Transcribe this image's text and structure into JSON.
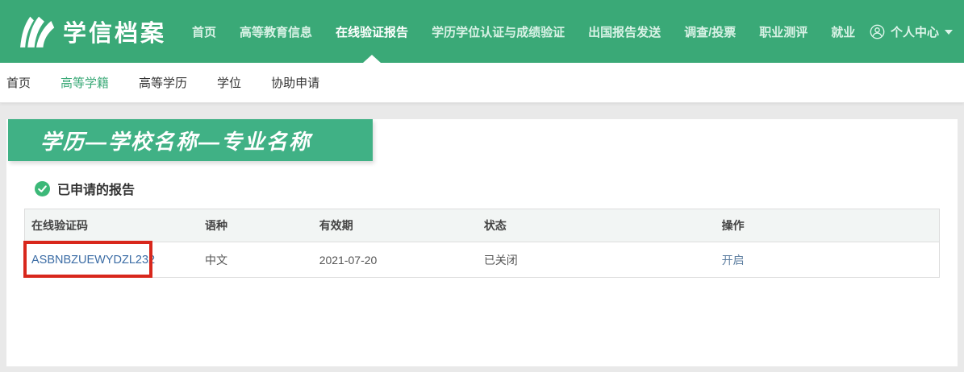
{
  "header": {
    "brand": "学信档案",
    "nav": [
      "首页",
      "高等教育信息",
      "在线验证报告",
      "学历学位认证与成绩验证",
      "出国报告发送",
      "调查/投票",
      "职业测评",
      "就业"
    ],
    "active_nav": "在线验证报告",
    "user_label": "个人中心"
  },
  "subnav": {
    "items": [
      "首页",
      "高等学籍",
      "高等学历",
      "学位",
      "协助申请"
    ],
    "active_item": "高等学籍"
  },
  "main": {
    "banner_title": "学历—学校名称—专业名称",
    "section_title": "已申请的报告",
    "table": {
      "headers": [
        "在线验证码",
        "语种",
        "有效期",
        "状态",
        "操作"
      ],
      "rows": [
        {
          "code": "ASBNBZUEWYDZL232",
          "language": "中文",
          "valid_until": "2021-07-20",
          "status": "已关闭",
          "action": "开启"
        }
      ]
    }
  },
  "colors": {
    "header_green": "#3aa977",
    "banner_green": "#40b185",
    "nav_text": "#d9f2e6",
    "active_subnav_green": "#3aa977",
    "code_link_blue": "#3b6ca5",
    "action_link_blue": "#5d7ea0",
    "annotation_red": "#d8271c",
    "check_icon_green": "#3cb878",
    "page_background": "#e9e9e9"
  }
}
